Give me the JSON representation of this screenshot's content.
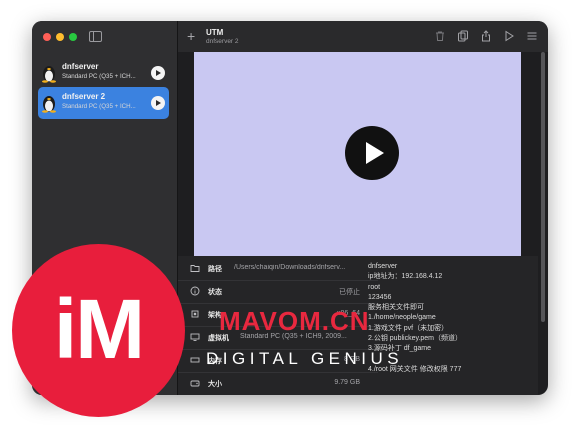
{
  "sidebar": {
    "vms": [
      {
        "name": "dnfserver",
        "subtitle": "Standard PC (Q35 + ICH..."
      },
      {
        "name": "dnfserver 2",
        "subtitle": "Standard PC (Q35 + ICH..."
      }
    ]
  },
  "toolbar": {
    "title": "UTM",
    "subtitle": "dnfserver 2",
    "icons": [
      "trash-icon",
      "clone-icon",
      "share-icon",
      "play-icon",
      "settings-icon"
    ]
  },
  "info": {
    "rows": [
      {
        "icon": "folder-icon",
        "label": "路径",
        "value": "/Users/chaiqin/Downloads/dnfserv..."
      },
      {
        "icon": "info-icon",
        "label": "状态",
        "value": "已停止"
      },
      {
        "icon": "cpu-icon",
        "label": "架构",
        "value": "x86_64"
      },
      {
        "icon": "monitor-icon",
        "label": "虚拟机",
        "value": "Standard PC (Q35 + ICH9, 2009..."
      },
      {
        "icon": "memory-icon",
        "label": "内存",
        "value": "8 GB"
      },
      {
        "icon": "disk-icon",
        "label": "大小",
        "value": "9.79 GB"
      }
    ],
    "notes": [
      "dnfserver",
      "ip地址为：192.168.4.12",
      "root",
      "123456",
      "服务相关文件即可",
      "1./home/neople/game",
      "1.游戏文件 pvf（未加密）",
      "2.公钥 publickey.pem（频道）",
      "3.源码补丁 df_game",
      "",
      "4./root 网关文件 修改权限 777"
    ]
  },
  "watermark": {
    "logo": "iM",
    "main": "MAVOM.CN",
    "sub": "DIGITAL GENIUS"
  }
}
